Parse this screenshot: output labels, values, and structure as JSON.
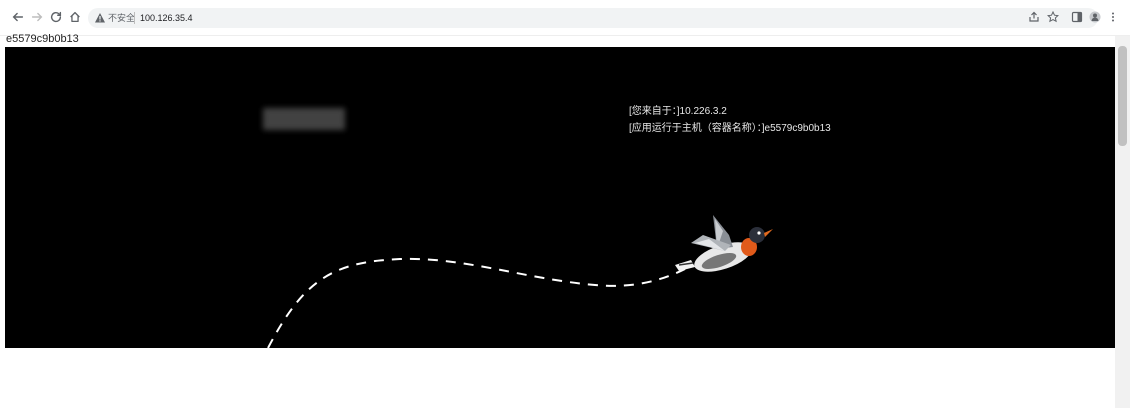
{
  "browser": {
    "security_label": "不安全",
    "url": "100.126.35.4"
  },
  "page": {
    "hostname_text": "e5579c9b0b13",
    "info_line_1": "[您来自于：]10.226.3.2",
    "info_line_2": "[应用运行于主机（容器名称）：]e5579c9b0b13"
  },
  "icons": {
    "back": "arrow-left-icon",
    "forward": "arrow-right-icon",
    "reload": "reload-icon",
    "home": "home-icon",
    "warning": "warning-triangle-icon",
    "share": "share-icon",
    "bookmark": "star-icon",
    "sidepanel": "sidepanel-icon",
    "profile": "profile-icon",
    "menu": "kebab-menu-icon"
  },
  "colors": {
    "stage_background": "#000000",
    "info_text": "#e8e8e8",
    "bird_orange": "#e05a1a"
  }
}
